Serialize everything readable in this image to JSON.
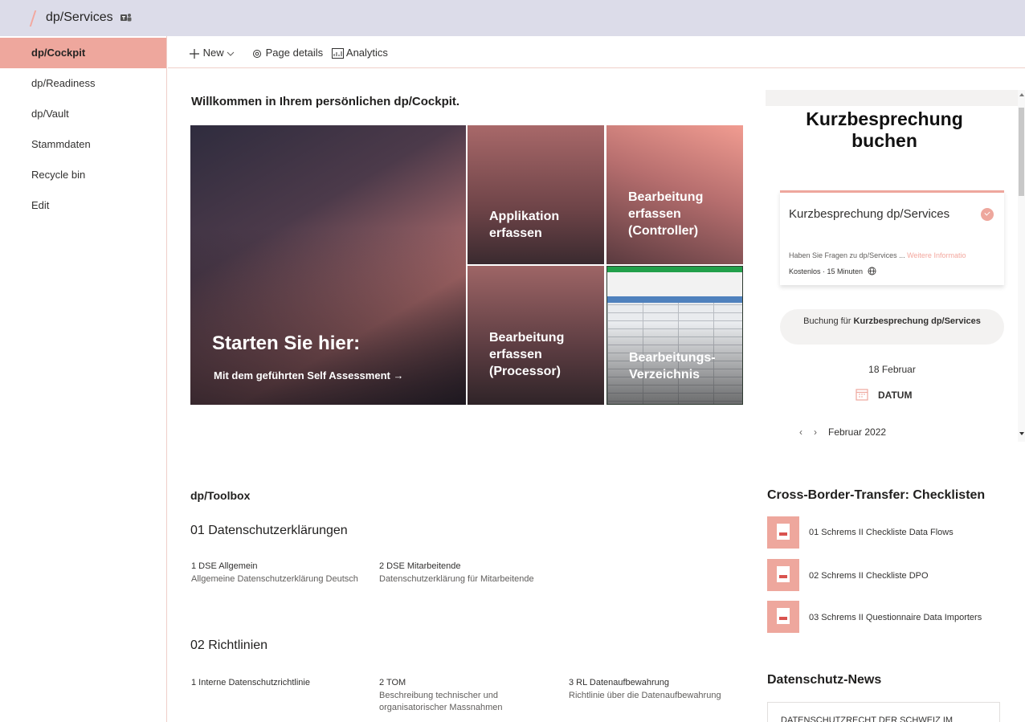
{
  "header": {
    "site_title": "dp/Services"
  },
  "nav": {
    "items": [
      {
        "label": "dp/Cockpit",
        "active": true
      },
      {
        "label": "dp/Readiness"
      },
      {
        "label": "dp/Vault"
      },
      {
        "label": "Stammdaten"
      },
      {
        "label": "Recycle bin"
      },
      {
        "label": "Edit"
      }
    ]
  },
  "commandbar": {
    "new": "New",
    "page_details": "Page details",
    "analytics": "Analytics"
  },
  "welcome": "Willkommen in Ihrem persönlichen dp/Cockpit.",
  "hero": {
    "main_title": "Starten Sie hier:",
    "main_sub": "Mit dem geführten Self Assessment →",
    "app": [
      "Applikation",
      "erfassen"
    ],
    "controller": [
      "Bearbeitung",
      "erfassen",
      "(Controller)"
    ],
    "processor": [
      "Bearbeitung",
      "erfassen",
      "(Processor)"
    ],
    "verzeichnis": [
      "Bearbeitungs-",
      "Verzeichnis"
    ]
  },
  "booking": {
    "title": "Kurzbesprechung buchen",
    "service": "Kurzbesprechung dp/Services",
    "question": "Haben Sie Fragen zu dp/Services ...",
    "more": "Weitere Informatio",
    "meta": "Kostenlos · 15 Minuten",
    "pill_prefix": "Buchung für",
    "pill_bold": "Kurzbesprechung dp/Services",
    "date": "18 Februar",
    "datum": "DATUM",
    "month": "Februar 2022"
  },
  "toolbox": {
    "title": "dp/Toolbox",
    "section1": {
      "title": "01 Datenschutzerklärungen",
      "links": [
        {
          "title": "1 DSE Allgemein",
          "desc": "Allgemeine Datenschutzerklärung Deutsch"
        },
        {
          "title": "2 DSE Mitarbeitende",
          "desc": "Datenschutzerklärung für Mitarbeitende"
        }
      ]
    },
    "section2": {
      "title": "02 Richtlinien",
      "links": [
        {
          "title": "1 Interne Datenschutzrichtlinie",
          "desc": ""
        },
        {
          "title": "2 TOM",
          "desc": "Beschreibung technischer und organisatorischer Massnahmen"
        },
        {
          "title": "3 RL Datenaufbewahrung",
          "desc": "Richtlinie über die Datenaufbewahrung"
        }
      ]
    }
  },
  "checklists": {
    "title": "Cross-Border-Transfer: Checklisten",
    "files": [
      "01 Schrems II Checkliste Data Flows",
      "02 Schrems II Checkliste DPO",
      "03 Schrems II Questionnaire Data Importers"
    ]
  },
  "news": {
    "title": "Datenschutz-News",
    "first_item": "DATENSCHUTZRECHT DER SCHWEIZ IM"
  },
  "colors": {
    "accent": "#eea79d",
    "header_bg": "#dcdce9"
  }
}
